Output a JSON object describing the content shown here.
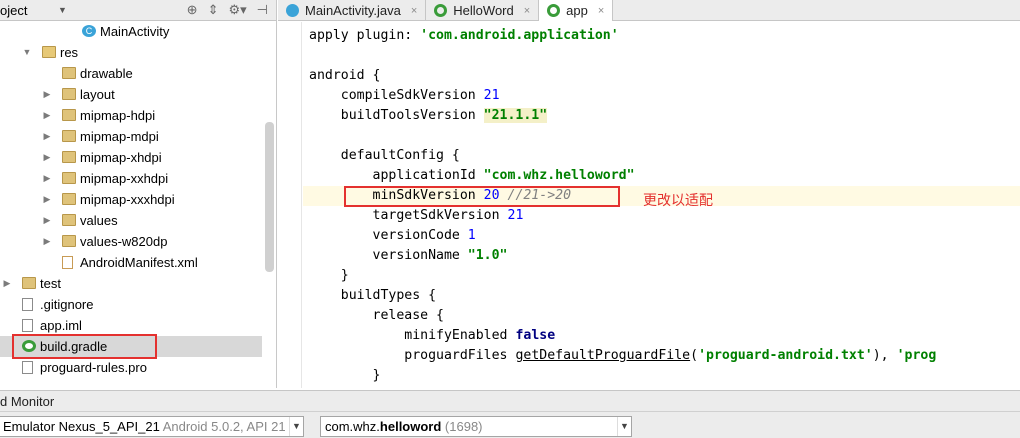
{
  "project_panel": {
    "title": "oject",
    "tree": [
      {
        "label": "MainActivity",
        "icon": "class-icon",
        "indent": 4,
        "arrow": ""
      },
      {
        "label": "res",
        "icon": "folder-icon",
        "indent": 2,
        "arrow": "▼"
      },
      {
        "label": "drawable",
        "icon": "folder-icon",
        "indent": 3,
        "arrow": ""
      },
      {
        "label": "layout",
        "icon": "folder-icon",
        "indent": 3,
        "arrow": "▶"
      },
      {
        "label": "mipmap-hdpi",
        "icon": "folder-icon",
        "indent": 3,
        "arrow": "▶"
      },
      {
        "label": "mipmap-mdpi",
        "icon": "folder-icon",
        "indent": 3,
        "arrow": "▶"
      },
      {
        "label": "mipmap-xhdpi",
        "icon": "folder-icon",
        "indent": 3,
        "arrow": "▶"
      },
      {
        "label": "mipmap-xxhdpi",
        "icon": "folder-icon",
        "indent": 3,
        "arrow": "▶"
      },
      {
        "label": "mipmap-xxxhdpi",
        "icon": "folder-icon",
        "indent": 3,
        "arrow": "▶"
      },
      {
        "label": "values",
        "icon": "folder-icon",
        "indent": 3,
        "arrow": "▶"
      },
      {
        "label": "values-w820dp",
        "icon": "folder-icon",
        "indent": 3,
        "arrow": "▶"
      },
      {
        "label": "AndroidManifest.xml",
        "icon": "xml-icon",
        "indent": 3,
        "arrow": ""
      },
      {
        "label": "test",
        "icon": "folder-icon",
        "indent": 1,
        "arrow": "▶"
      },
      {
        "label": ".gitignore",
        "icon": "file-icon",
        "indent": 1,
        "arrow": ""
      },
      {
        "label": "app.iml",
        "icon": "file-icon",
        "indent": 1,
        "arrow": ""
      },
      {
        "label": "build.gradle",
        "icon": "gradle-icon",
        "indent": 1,
        "arrow": "",
        "selected": true
      },
      {
        "label": "proguard-rules.pro",
        "icon": "file-icon",
        "indent": 1,
        "arrow": ""
      }
    ]
  },
  "tabs": [
    {
      "label": "MainActivity.java",
      "icon": "class-icon",
      "active": false
    },
    {
      "label": "HelloWord",
      "icon": "gradle-icon",
      "active": false
    },
    {
      "label": "app",
      "icon": "gradle-icon",
      "active": true
    }
  ],
  "code": {
    "lines": [
      [
        [
          "apply plugin: ",
          ""
        ],
        [
          "'com.android.application'",
          "s"
        ]
      ],
      [],
      [
        [
          "android {",
          ""
        ]
      ],
      [
        [
          "    compileSdkVersion ",
          ""
        ],
        [
          "21",
          "n"
        ]
      ],
      [
        [
          "    buildToolsVersion ",
          ""
        ],
        [
          "\"21.1.1\"",
          "s sh"
        ]
      ],
      [],
      [
        [
          "    defaultConfig {",
          ""
        ]
      ],
      [
        [
          "        applicationId ",
          ""
        ],
        [
          "\"com.whz.helloword\"",
          "s"
        ]
      ],
      [
        [
          "        minSdkVersion ",
          ""
        ],
        [
          "20",
          "n"
        ],
        [
          " //21->20",
          "c"
        ]
      ],
      [
        [
          "        targetSdkVersion ",
          ""
        ],
        [
          "21",
          "n"
        ]
      ],
      [
        [
          "        versionCode ",
          ""
        ],
        [
          "1",
          "n"
        ]
      ],
      [
        [
          "        versionName ",
          ""
        ],
        [
          "\"1.0\"",
          "s"
        ]
      ],
      [
        [
          "    }",
          ""
        ]
      ],
      [
        [
          "    buildTypes {",
          ""
        ]
      ],
      [
        [
          "        release {",
          ""
        ]
      ],
      [
        [
          "            minifyEnabled ",
          ""
        ],
        [
          "false",
          "k"
        ]
      ],
      [
        [
          "            proguardFiles ",
          ""
        ],
        [
          "getDefaultProguardFile",
          "u"
        ],
        [
          "(",
          ""
        ],
        [
          "'proguard-android.txt'",
          "s"
        ],
        [
          "), ",
          ""
        ],
        [
          "'prog",
          "s"
        ]
      ],
      [
        [
          "        }",
          ""
        ]
      ]
    ],
    "highlight_line": 8
  },
  "annotation": "更改以适配",
  "bottom": {
    "monitor_label": "d Monitor",
    "device_name": "Emulator Nexus_5_API_21",
    "device_info": "Android 5.0.2, API 21",
    "process_prefix": "com.whz.",
    "process_bold": "helloword",
    "process_pid": "(1698)"
  },
  "colors": {
    "annotation_red": "#e4312f",
    "string_green": "#008000",
    "number_blue": "#0000ff"
  }
}
